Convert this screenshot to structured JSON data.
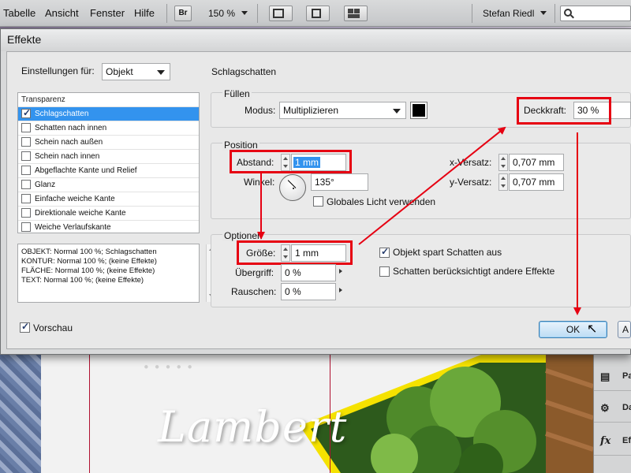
{
  "menubar": {
    "items": [
      "Tabelle",
      "Ansicht",
      "Fenster",
      "Hilfe"
    ],
    "bridge_label": "Br",
    "zoom": "150 %",
    "user": "Stefan Riedl"
  },
  "dialog": {
    "title": "Effekte",
    "settings_for_label": "Einstellungen für:",
    "settings_for_value": "Objekt",
    "section_heading": "Schlagschatten",
    "effects_header": "Transparenz",
    "effects": [
      {
        "label": "Schlagschatten",
        "checked": true,
        "selected": true
      },
      {
        "label": "Schatten nach innen",
        "checked": false
      },
      {
        "label": "Schein nach außen",
        "checked": false
      },
      {
        "label": "Schein nach innen",
        "checked": false
      },
      {
        "label": "Abgeflachte Kante und Relief",
        "checked": false
      },
      {
        "label": "Glanz",
        "checked": false
      },
      {
        "label": "Einfache weiche Kante",
        "checked": false
      },
      {
        "label": "Direktionale weiche Kante",
        "checked": false
      },
      {
        "label": "Weiche Verlaufskante",
        "checked": false
      }
    ],
    "summary": [
      "OBJEKT: Normal 100 %; Schlagschatten",
      "KONTUR: Normal 100 %; (keine Effekte)",
      "FLÄCHE: Normal 100 %; (keine Effekte)",
      "TEXT: Normal 100 %; (keine Effekte)"
    ],
    "fill": {
      "title": "Füllen",
      "mode_label": "Modus:",
      "mode_value": "Multiplizieren",
      "color": "#000000",
      "opacity_label": "Deckkraft:",
      "opacity_value": "30 %"
    },
    "position": {
      "title": "Position",
      "distance_label": "Abstand:",
      "distance_value": "1 mm",
      "angle_label": "Winkel:",
      "angle_value": "135°",
      "global_light_label": "Globales Licht verwenden",
      "global_light_checked": false,
      "x_offset_label": "x-Versatz:",
      "x_offset_value": "0,707 mm",
      "y_offset_label": "y-Versatz:",
      "y_offset_value": "0,707 mm"
    },
    "options": {
      "title": "Optionen",
      "size_label": "Größe:",
      "size_value": "1 mm",
      "spread_label": "Übergriff:",
      "spread_value": "0 %",
      "noise_label": "Rauschen:",
      "noise_value": "0 %",
      "knockout_label": "Objekt spart Schatten aus",
      "knockout_checked": true,
      "honor_effects_label": "Schatten berücksichtigt andere Effekte",
      "honor_effects_checked": false
    },
    "preview_label": "Vorschau",
    "preview_checked": true,
    "ok_label": "OK",
    "cancel_label_partial": "A"
  },
  "background": {
    "signature": "Lambert"
  },
  "right_panel": {
    "items": [
      {
        "icon": "pages-icon",
        "label": "Pa"
      },
      {
        "icon": "data-merge-icon",
        "label": "Da"
      },
      {
        "icon": "effects-icon",
        "label": "Eff"
      }
    ]
  },
  "colors": {
    "annotation": "#e60012",
    "selection": "#3393ee"
  }
}
